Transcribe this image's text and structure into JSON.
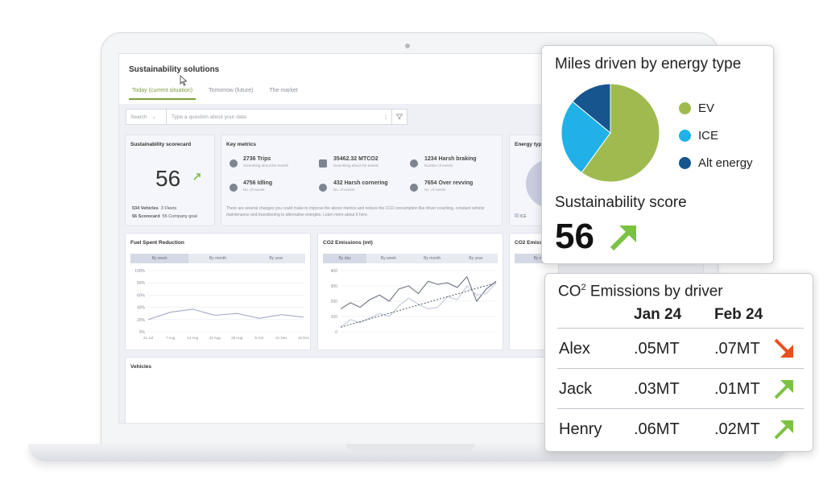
{
  "app": {
    "title": "Sustainability solutions",
    "tabs": [
      {
        "label": "Today (current situation)",
        "active": true
      },
      {
        "label": "Tomorrow (future)",
        "active": false
      },
      {
        "label": "The market",
        "active": false
      }
    ]
  },
  "search": {
    "select_label": "Search",
    "placeholder": "Type a question about your data"
  },
  "scorecard": {
    "title": "Sustainability scorecard",
    "score": "56",
    "vehicles": "534 Vehicles",
    "fleets": "3 Fleets",
    "scorecard": "56 Scorecard",
    "goal": "55 Company goal"
  },
  "key_metrics": {
    "title": "Key metrics",
    "items": [
      {
        "value": "2736 Trips",
        "sub": "Something about the events",
        "icon": "location-pin-icon"
      },
      {
        "value": "35462.32 MTCO2",
        "sub": "Something about the events",
        "icon": "truck-icon"
      },
      {
        "value": "1234 Harsh braking",
        "sub": "Number of events",
        "icon": "brake-icon"
      },
      {
        "value": "4756 Idling",
        "sub": "No. of events",
        "icon": "clock-icon"
      },
      {
        "value": "432 Harsh cornering",
        "sub": "No. of events",
        "icon": "cornering-icon"
      },
      {
        "value": "7654 Over revving",
        "sub": "No. of events",
        "icon": "gauge-icon"
      }
    ],
    "note": "There are several changes you could make to improve the above metrics and reduce the CO2 consumption like driver coaching, constant vehicle maintenance and transitioning to alternative energies. Learn more about it here."
  },
  "energy_card": {
    "title": "Energy typ",
    "legend": "ICE"
  },
  "fuel_chart": {
    "title": "Fuel Spent Reduction",
    "segments": [
      "By week",
      "By month",
      "By year"
    ],
    "yticks": [
      "100%",
      "80%",
      "60%",
      "40%",
      "20%",
      "0%"
    ],
    "xticks": [
      "21 Jul",
      "7 Aug",
      "14 Aug",
      "21 Aug",
      "28 Aug",
      "5 Oct",
      "21 Dec",
      "16 Dec"
    ]
  },
  "co2_chart": {
    "title": "CO2 Emissions (mt)",
    "segments": [
      "By day",
      "By week",
      "By month",
      "By year"
    ],
    "yticks": [
      "400",
      "300",
      "200",
      "100",
      "0"
    ]
  },
  "co2b_card": {
    "title": "CO2 Emiss",
    "segment": "By da"
  },
  "vehicles": {
    "title": "Vehicles"
  },
  "chart_data": [
    {
      "type": "pie",
      "title": "Miles driven by energy type",
      "categories": [
        "EV",
        "ICE",
        "Alt energy"
      ],
      "values": [
        60,
        26,
        14
      ],
      "colors": [
        "#9fbb50",
        "#20b1e8",
        "#17558e"
      ],
      "legend": "right"
    },
    {
      "type": "line",
      "title": "Fuel Spent Reduction",
      "x": [
        "21 Jul",
        "7 Aug",
        "14 Aug",
        "21 Aug",
        "28 Aug",
        "5 Oct",
        "21 Dec",
        "16 Dec"
      ],
      "series": [
        {
          "values": [
            20,
            32,
            37,
            27,
            30,
            22,
            28,
            24
          ]
        }
      ],
      "ylim": [
        0,
        100
      ]
    },
    {
      "type": "line",
      "title": "CO2 Emissions (mt)",
      "series": [
        {
          "values": [
            150,
            190,
            160,
            210,
            240,
            200,
            280,
            300,
            250,
            330,
            310,
            320,
            290,
            360,
            200,
            280,
            330
          ]
        },
        {
          "values": [
            30,
            80,
            60,
            90,
            120,
            100,
            170,
            220,
            180,
            150,
            160,
            230,
            210,
            300,
            240,
            250,
            320
          ]
        }
      ],
      "ylim": [
        0,
        400
      ]
    }
  ],
  "overlay_pie": {
    "title": "Miles driven by energy type",
    "legend": [
      {
        "label": "EV",
        "color": "#9fbb50"
      },
      {
        "label": "ICE",
        "color": "#20b1e8"
      },
      {
        "label": "Alt energy",
        "color": "#17558e"
      }
    ],
    "score_label": "Sustainability score",
    "score_value": "56"
  },
  "overlay_table": {
    "title_main": "CO",
    "title_sup": "2",
    "title_rest": " Emissions by driver",
    "columns": [
      "Jan 24",
      "Feb 24"
    ],
    "rows": [
      {
        "name": "Alex",
        "jan": ".05MT",
        "feb": ".07MT",
        "trend": "down"
      },
      {
        "name": "Jack",
        "jan": ".03MT",
        "feb": ".01MT",
        "trend": "up"
      },
      {
        "name": "Henry",
        "jan": ".06MT",
        "feb": ".02MT",
        "trend": "up"
      }
    ]
  },
  "colors": {
    "accent_green": "#7cc242",
    "down_red": "#e8501e",
    "tab_green": "#7ba03c"
  }
}
